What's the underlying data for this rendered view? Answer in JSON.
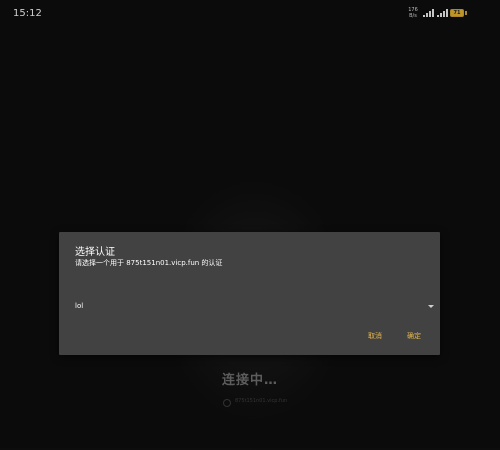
{
  "status_bar": {
    "time": "15:12",
    "net_speed_value": "176",
    "net_speed_unit": "B/s",
    "battery_level": "71",
    "battery_color": "#e0b030"
  },
  "background": {
    "connecting_text": "连接中…",
    "host_text": "875t151n01.vicp.fun"
  },
  "dialog": {
    "title": "选择认证",
    "message": "请选择一个用于 875t151n01.vicp.fun 的认证",
    "selected_option": "lol",
    "cancel_label": "取消",
    "ok_label": "确定",
    "accent_color": "#e8b84a",
    "background_color": "#424242"
  }
}
